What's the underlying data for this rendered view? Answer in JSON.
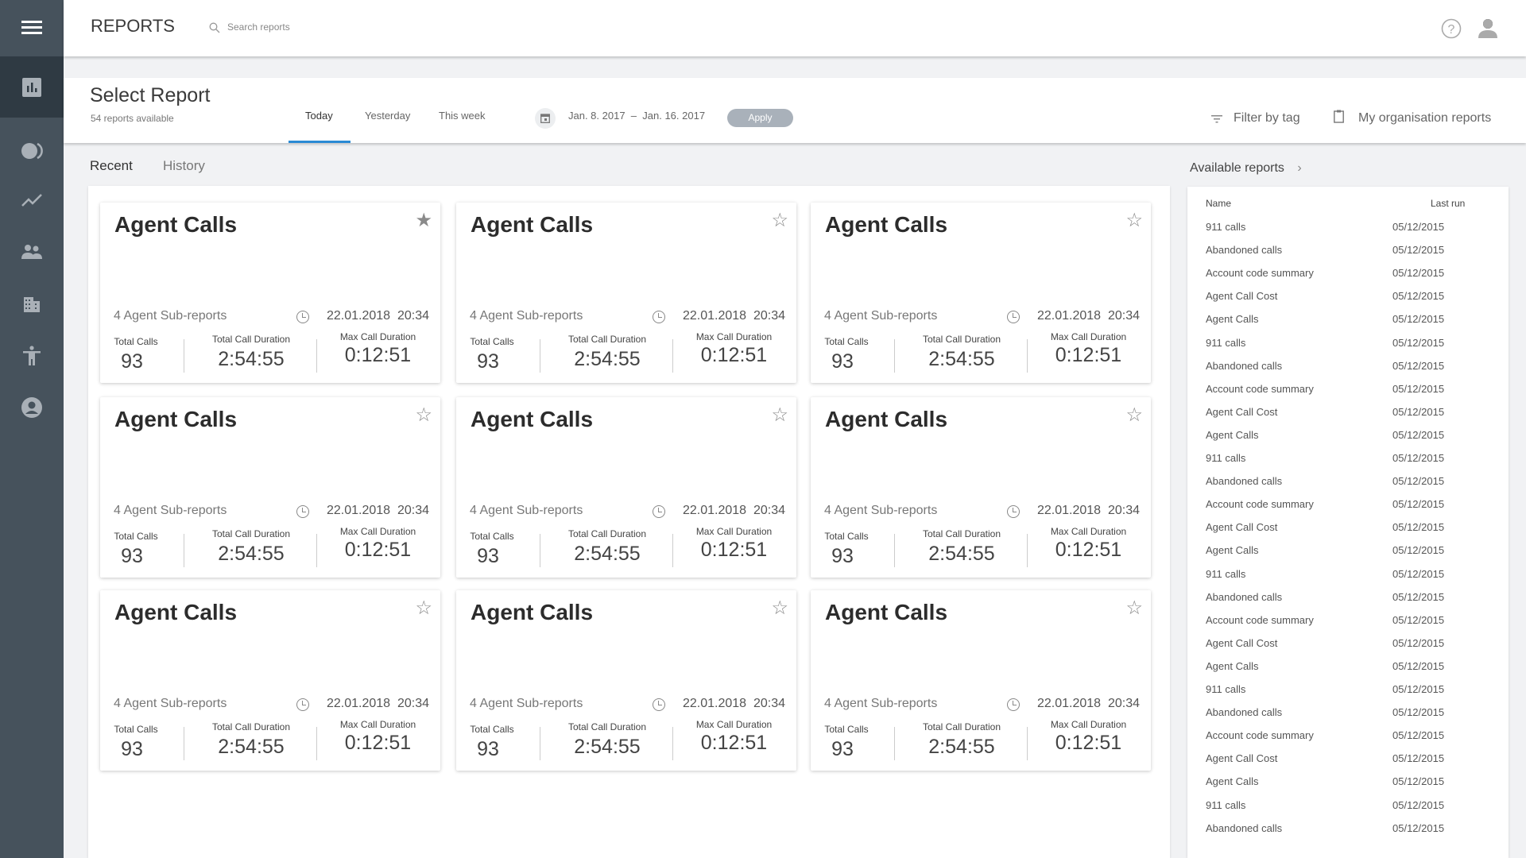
{
  "app": {
    "title": "REPORTS",
    "search_placeholder": "Search reports"
  },
  "sidebar": {
    "items": [
      {
        "icon": "menu-icon"
      },
      {
        "icon": "bar-chart-icon",
        "active": true
      },
      {
        "icon": "toggle-circles-icon"
      },
      {
        "icon": "trending-icon"
      },
      {
        "icon": "people-icon"
      },
      {
        "icon": "building-icon"
      },
      {
        "icon": "accessibility-icon"
      },
      {
        "icon": "account-circle-icon"
      }
    ]
  },
  "header_icons": [
    "help-icon",
    "user-icon"
  ],
  "select": {
    "title": "Select Report",
    "subtitle": "54 reports available",
    "tabs": [
      {
        "label": "Today",
        "active": true
      },
      {
        "label": "Yesterday"
      },
      {
        "label": "This week"
      }
    ],
    "date_from": "Jan. 8. 2017",
    "date_sep": "–",
    "date_to": "Jan. 16. 2017",
    "apply": "Apply",
    "filter": "Filter by tag",
    "org": "My organisation reports"
  },
  "view_tabs": {
    "recent": "Recent",
    "history": "History"
  },
  "accent": "#2a8ad4",
  "cards": [
    {
      "title": "Agent Calls",
      "starred": true,
      "sub": "4 Agent Sub-reports",
      "date": "22.01.2018  20:34",
      "total_calls_label": "Total Calls",
      "total_calls": "93",
      "total_dur_label": "Total Call Duration",
      "total_dur": "2:54:55",
      "max_dur_label": "Max Call Duration",
      "max_dur": "0:12:51"
    },
    {
      "title": "Agent Calls",
      "starred": false,
      "sub": "4 Agent Sub-reports",
      "date": "22.01.2018  20:34",
      "total_calls_label": "Total Calls",
      "total_calls": "93",
      "total_dur_label": "Total Call Duration",
      "total_dur": "2:54:55",
      "max_dur_label": "Max Call Duration",
      "max_dur": "0:12:51"
    },
    {
      "title": "Agent Calls",
      "starred": false,
      "sub": "4 Agent Sub-reports",
      "date": "22.01.2018  20:34",
      "total_calls_label": "Total Calls",
      "total_calls": "93",
      "total_dur_label": "Total Call Duration",
      "total_dur": "2:54:55",
      "max_dur_label": "Max Call Duration",
      "max_dur": "0:12:51"
    },
    {
      "title": "Agent Calls",
      "starred": false,
      "sub": "4 Agent Sub-reports",
      "date": "22.01.2018  20:34",
      "total_calls_label": "Total Calls",
      "total_calls": "93",
      "total_dur_label": "Total Call Duration",
      "total_dur": "2:54:55",
      "max_dur_label": "Max Call Duration",
      "max_dur": "0:12:51"
    },
    {
      "title": "Agent Calls",
      "starred": false,
      "sub": "4 Agent Sub-reports",
      "date": "22.01.2018  20:34",
      "total_calls_label": "Total Calls",
      "total_calls": "93",
      "total_dur_label": "Total Call Duration",
      "total_dur": "2:54:55",
      "max_dur_label": "Max Call Duration",
      "max_dur": "0:12:51"
    },
    {
      "title": "Agent Calls",
      "starred": false,
      "sub": "4 Agent Sub-reports",
      "date": "22.01.2018  20:34",
      "total_calls_label": "Total Calls",
      "total_calls": "93",
      "total_dur_label": "Total Call Duration",
      "total_dur": "2:54:55",
      "max_dur_label": "Max Call Duration",
      "max_dur": "0:12:51"
    },
    {
      "title": "Agent Calls",
      "starred": false,
      "sub": "4 Agent Sub-reports",
      "date": "22.01.2018  20:34",
      "total_calls_label": "Total Calls",
      "total_calls": "93",
      "total_dur_label": "Total Call Duration",
      "total_dur": "2:54:55",
      "max_dur_label": "Max Call Duration",
      "max_dur": "0:12:51"
    },
    {
      "title": "Agent Calls",
      "starred": false,
      "sub": "4 Agent Sub-reports",
      "date": "22.01.2018  20:34",
      "total_calls_label": "Total Calls",
      "total_calls": "93",
      "total_dur_label": "Total Call Duration",
      "total_dur": "2:54:55",
      "max_dur_label": "Max Call Duration",
      "max_dur": "0:12:51"
    },
    {
      "title": "Agent Calls",
      "starred": false,
      "sub": "4 Agent Sub-reports",
      "date": "22.01.2018  20:34",
      "total_calls_label": "Total Calls",
      "total_calls": "93",
      "total_dur_label": "Total Call Duration",
      "total_dur": "2:54:55",
      "max_dur_label": "Max Call Duration",
      "max_dur": "0:12:51"
    }
  ],
  "available": {
    "title": "Available reports",
    "col_name": "Name",
    "col_last": "Last run",
    "rows": [
      [
        "911 calls",
        "05/12/2015"
      ],
      [
        "Abandoned calls",
        "05/12/2015"
      ],
      [
        "Account code summary",
        "05/12/2015"
      ],
      [
        "Agent Call Cost",
        "05/12/2015"
      ],
      [
        "Agent Calls",
        "05/12/2015"
      ],
      [
        "911 calls",
        "05/12/2015"
      ],
      [
        "Abandoned calls",
        "05/12/2015"
      ],
      [
        "Account code summary",
        "05/12/2015"
      ],
      [
        "Agent Call Cost",
        "05/12/2015"
      ],
      [
        "Agent Calls",
        "05/12/2015"
      ],
      [
        "911 calls",
        "05/12/2015"
      ],
      [
        "Abandoned calls",
        "05/12/2015"
      ],
      [
        "Account code summary",
        "05/12/2015"
      ],
      [
        "Agent Call Cost",
        "05/12/2015"
      ],
      [
        "Agent Calls",
        "05/12/2015"
      ],
      [
        "911 calls",
        "05/12/2015"
      ],
      [
        "Abandoned calls",
        "05/12/2015"
      ],
      [
        "Account code summary",
        "05/12/2015"
      ],
      [
        "Agent Call Cost",
        "05/12/2015"
      ],
      [
        "Agent Calls",
        "05/12/2015"
      ],
      [
        "911 calls",
        "05/12/2015"
      ],
      [
        "Abandoned calls",
        "05/12/2015"
      ],
      [
        "Account code summary",
        "05/12/2015"
      ],
      [
        "Agent Call Cost",
        "05/12/2015"
      ],
      [
        "Agent Calls",
        "05/12/2015"
      ],
      [
        "911 calls",
        "05/12/2015"
      ],
      [
        "Abandoned calls",
        "05/12/2015"
      ]
    ]
  }
}
